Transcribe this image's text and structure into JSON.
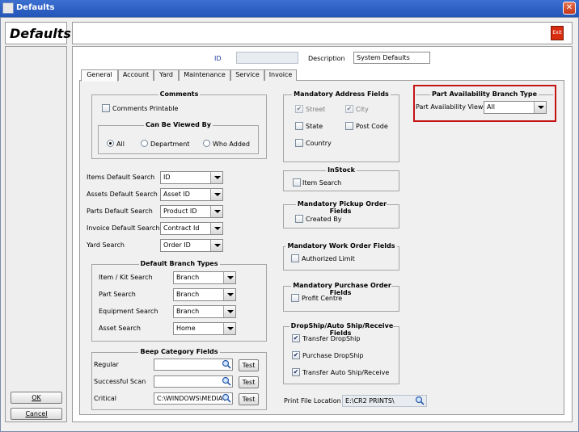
{
  "window": {
    "title": "Defaults",
    "close_glyph": "✕"
  },
  "heading": "Defaults",
  "exit_label": "Exit",
  "left_buttons": {
    "ok": "OK",
    "cancel": "Cancel"
  },
  "top": {
    "id_label": "ID",
    "id_value": "",
    "desc_label": "Description",
    "desc_value": "System Defaults"
  },
  "tabs": [
    "General",
    "Account",
    "Yard",
    "Maintenance",
    "Service",
    "Invoice"
  ],
  "comments": {
    "title": "Comments",
    "printable_label": "Comments Printable",
    "viewed_title": "Can Be Viewed By",
    "options": [
      "All",
      "Department",
      "Who Added"
    ]
  },
  "searches": [
    {
      "label": "Items Default Search",
      "value": "ID"
    },
    {
      "label": "Assets Default Search",
      "value": "Asset ID"
    },
    {
      "label": "Parts Default Search",
      "value": "Product ID"
    },
    {
      "label": "Invoice Default Search",
      "value": "Contract Id"
    },
    {
      "label": "Yard Search",
      "value": "Order ID"
    }
  ],
  "branch_types": {
    "title": "Default Branch Types",
    "rows": [
      {
        "label": "Item / Kit Search",
        "value": "Branch"
      },
      {
        "label": "Part Search",
        "value": "Branch"
      },
      {
        "label": "Equipment Search",
        "value": "Branch"
      },
      {
        "label": "Asset Search",
        "value": "Home"
      }
    ]
  },
  "beep": {
    "title": "Beep Category Fields",
    "rows": [
      {
        "label": "Regular",
        "value": ""
      },
      {
        "label": "Successful Scan",
        "value": ""
      },
      {
        "label": "Critical",
        "value": "C:\\WINDOWS\\MEDIA\\"
      }
    ],
    "test_label": "Test"
  },
  "address": {
    "title": "Mandatory Address Fields",
    "street": "Street",
    "city": "City",
    "state": "State",
    "postcode": "Post Code",
    "country": "Country"
  },
  "instock": {
    "title": "InStock",
    "item_search": "Item Search"
  },
  "pickup": {
    "title": "Mandatory Pickup Order Fields",
    "created_by": "Created By"
  },
  "work_order": {
    "title": "Mandatory Work Order Fields",
    "authorized_limit": "Authorized Limit"
  },
  "purchase_order": {
    "title": "Mandatory Purchase Order Fields",
    "profit_centre": "Profit Centre"
  },
  "dropship": {
    "title": "DropShip/Auto Ship/Receive Fields",
    "transfer": "Transfer DropShip",
    "purchase": "Purchase DropShip",
    "auto": "Transfer Auto Ship/Receive"
  },
  "print_file": {
    "label": "Print File Location",
    "value": "E:\\CR2 PRINTS\\"
  },
  "part_availability": {
    "title": "Part Availability Branch Type",
    "view_label": "Part Availability View",
    "value": "All"
  },
  "colors": {
    "highlight": "#c41414",
    "titlebar": "#2455b8"
  },
  "check_glyph": "✔"
}
